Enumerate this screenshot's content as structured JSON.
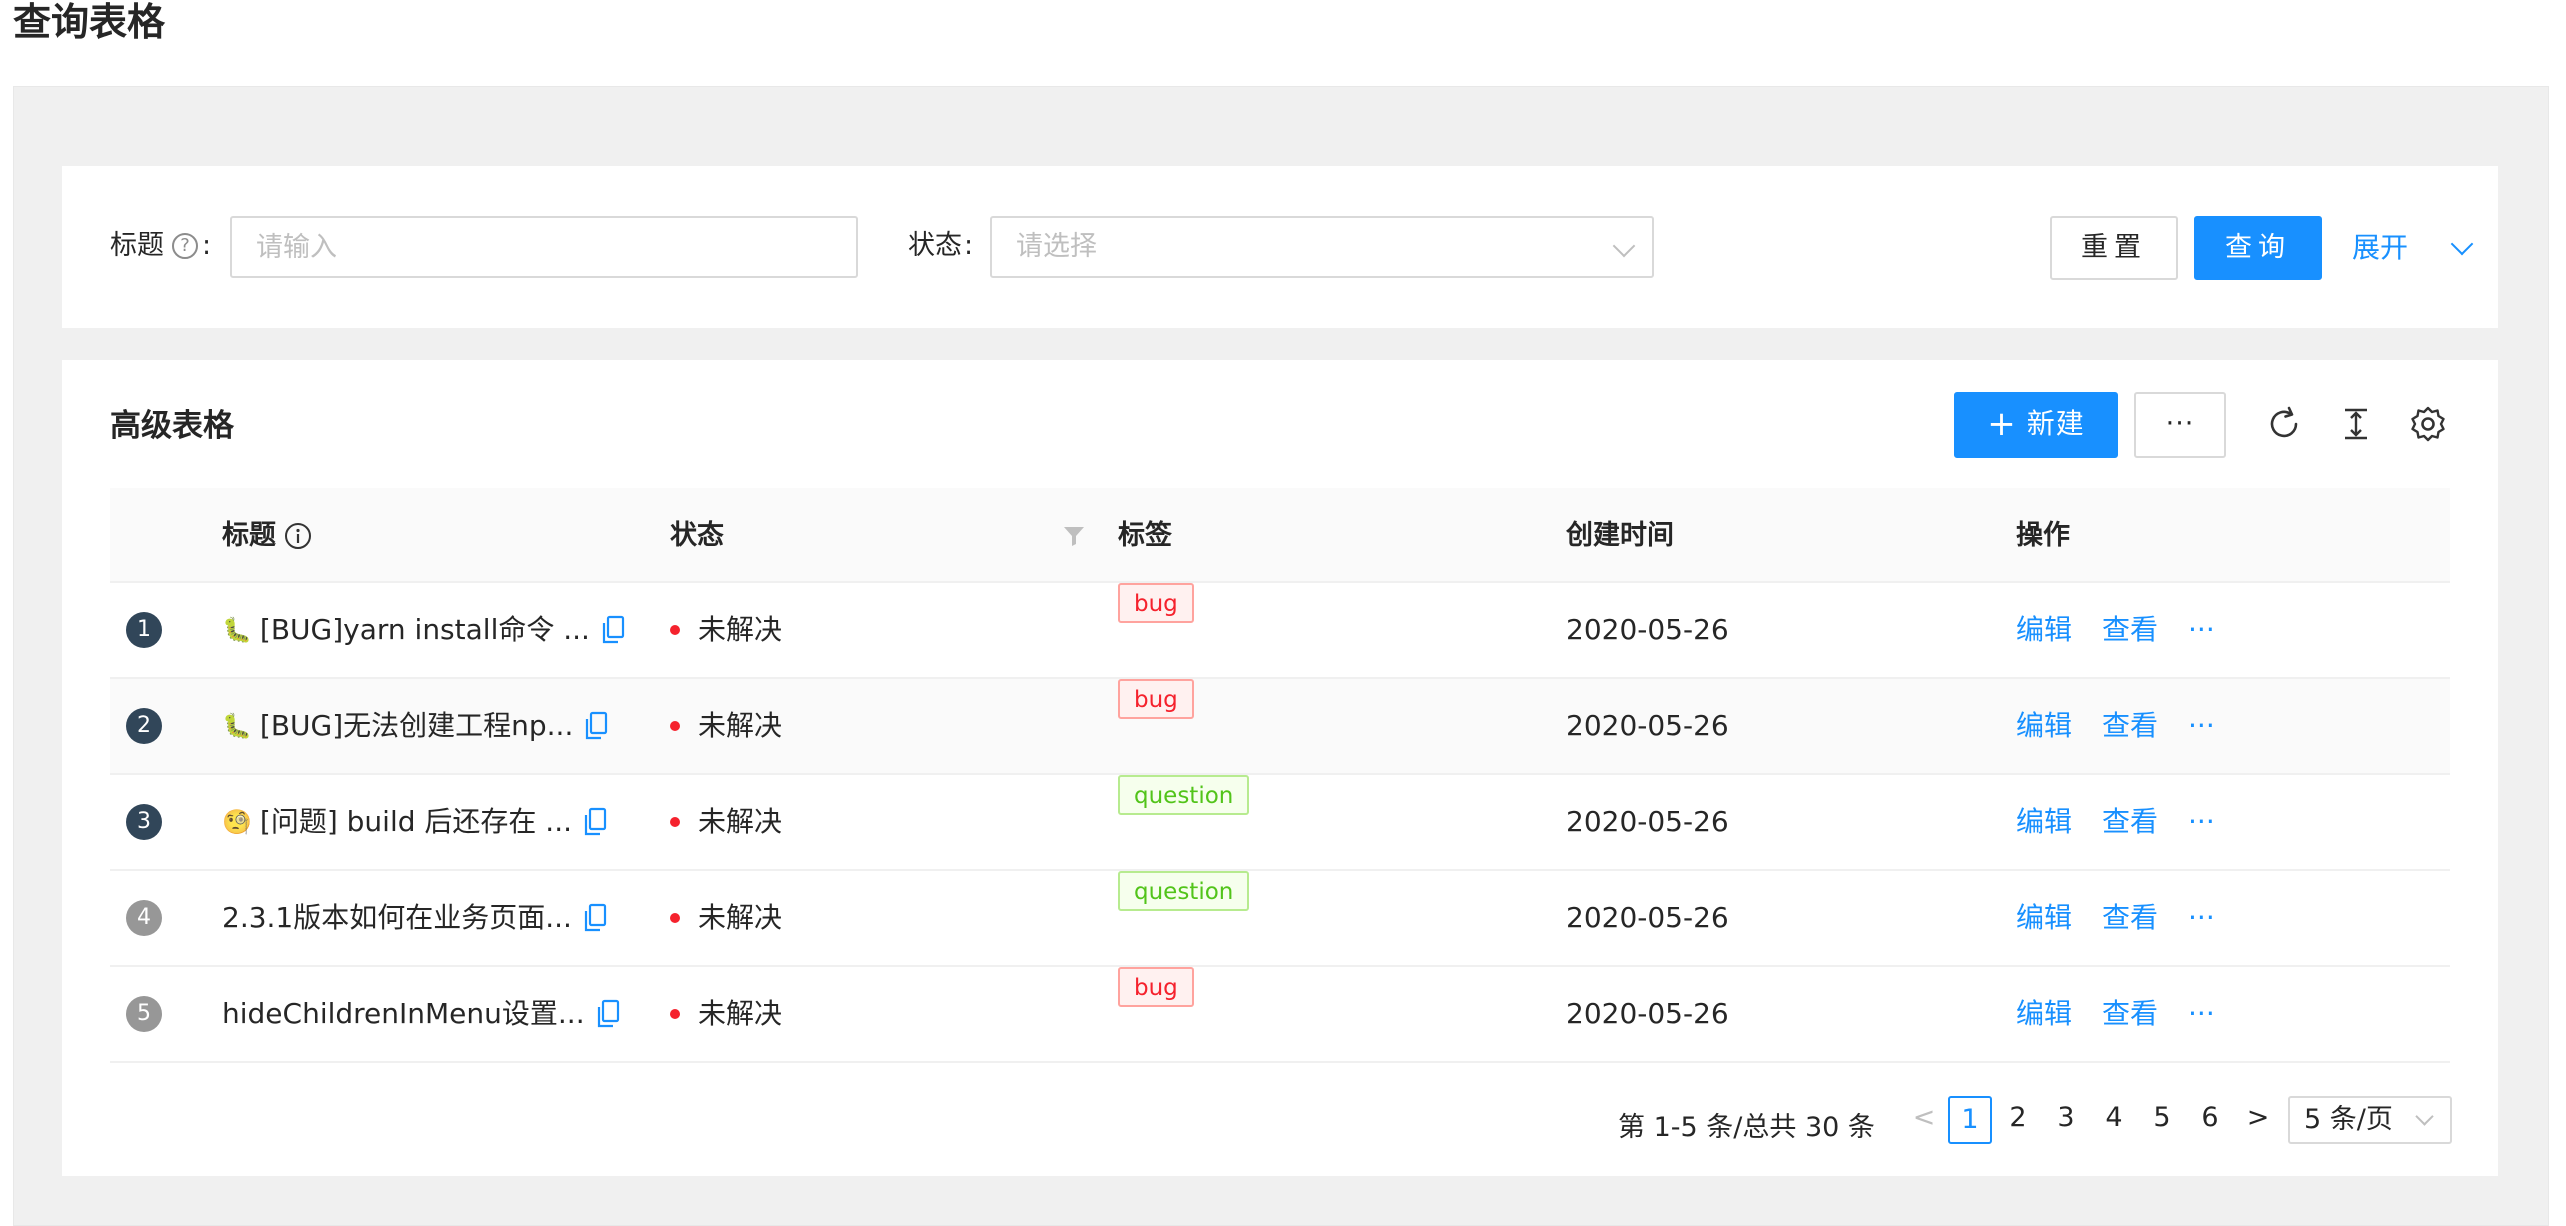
{
  "page": {
    "title": "查询表格"
  },
  "search": {
    "title_label": "标题",
    "title_colon": ":",
    "title_placeholder": "请输入",
    "status_label": "状态",
    "status_colon": ":",
    "status_placeholder": "请选择",
    "reset_label": "重置",
    "query_label": "查询",
    "expand_label": "展开"
  },
  "table": {
    "title": "高级表格",
    "new_label": "新建",
    "more_label": "···",
    "columns": {
      "title": "标题",
      "status": "状态",
      "tags": "标签",
      "created_at": "创建时间",
      "actions": "操作"
    },
    "rows": [
      {
        "index": "1",
        "emoji": "🐛",
        "title": "[BUG]yarn install命令 ...",
        "status": "未解决",
        "tag": "bug",
        "date": "2020-05-26",
        "edit": "编辑",
        "view": "查看",
        "more": "···"
      },
      {
        "index": "2",
        "emoji": "🐛",
        "title": "[BUG]无法创建工程np...",
        "status": "未解决",
        "tag": "bug",
        "date": "2020-05-26",
        "edit": "编辑",
        "view": "查看",
        "more": "···"
      },
      {
        "index": "3",
        "emoji": "🧐",
        "title": "[问题] build 后还存在 ...",
        "status": "未解决",
        "tag": "question",
        "date": "2020-05-26",
        "edit": "编辑",
        "view": "查看",
        "more": "···"
      },
      {
        "index": "4",
        "emoji": "",
        "title": "2.3.1版本如何在业务页面...",
        "status": "未解决",
        "tag": "question",
        "date": "2020-05-26",
        "edit": "编辑",
        "view": "查看",
        "more": "···"
      },
      {
        "index": "5",
        "emoji": "",
        "title": "hideChildrenInMenu设置...",
        "status": "未解决",
        "tag": "bug",
        "date": "2020-05-26",
        "edit": "编辑",
        "view": "查看",
        "more": "···"
      }
    ]
  },
  "pagination": {
    "total_text": "第 1-5 条/总共 30 条",
    "prev": "<",
    "next": ">",
    "pages": [
      "1",
      "2",
      "3",
      "4",
      "5",
      "6"
    ],
    "current": "1",
    "page_size": "5 条/页"
  },
  "icons": {
    "help": "question-circle-icon",
    "info": "info-circle-icon",
    "filter": "filter-icon",
    "copy": "copy-icon",
    "reload": "reload-icon",
    "density": "column-height-icon",
    "settings": "setting-icon",
    "plus": "plus-icon",
    "chevron": "chevron-down-icon"
  },
  "colors": {
    "primary": "#1890ff",
    "error": "#f5222d",
    "success": "#52c41a",
    "index_dark": "#314659",
    "index_light": "#979797",
    "background": "#f0f0f0"
  }
}
